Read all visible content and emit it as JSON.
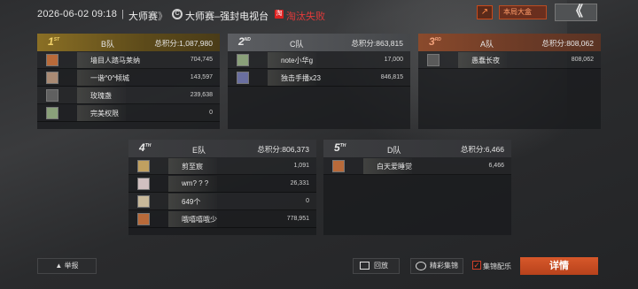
{
  "header": {
    "datetime": "2026-06-02 09:18",
    "separator": "|",
    "mode": "大师赛",
    "chevrons": "》",
    "ring_glyph": "C",
    "match_name": "大师赛–强封电视台",
    "result_box": "淘",
    "result_text": "淘汰失败",
    "share_glyph": "↗",
    "watch_label": "本局大盒",
    "back_glyph": "《"
  },
  "teams": [
    {
      "rank": "1",
      "rank_suffix": "ST",
      "name": "B队",
      "score_label": "总积分:1,087,980",
      "players": [
        {
          "name": "墙目人踏马莱纳",
          "score": "704,745"
        },
        {
          "name": "一谐^0^倾城",
          "score": "143,597"
        },
        {
          "name": "玫瑰盏",
          "score": "239,638"
        },
        {
          "name": "完美权限",
          "score": "0"
        }
      ]
    },
    {
      "rank": "2",
      "rank_suffix": "ND",
      "name": "C队",
      "score_label": "总积分:863,815",
      "players": [
        {
          "name": "note小华g",
          "score": "17,000"
        },
        {
          "name": "独击手播x23",
          "score": "846,815"
        }
      ]
    },
    {
      "rank": "3",
      "rank_suffix": "RD",
      "name": "A队",
      "score_label": "总积分:808,062",
      "players": [
        {
          "name": "愚蠢长夜",
          "score": "808,062"
        }
      ]
    },
    {
      "rank": "4",
      "rank_suffix": "TH",
      "name": "E队",
      "score_label": "总积分:806,373",
      "players": [
        {
          "name": "剪至宸",
          "score": "1,091"
        },
        {
          "name": "wm? ? ?",
          "score": "26,331"
        },
        {
          "name": "649个",
          "score": "0"
        },
        {
          "name": "哦嘻嘻哦少",
          "score": "778,951"
        }
      ]
    },
    {
      "rank": "5",
      "rank_suffix": "TH",
      "name": "D队",
      "score_label": "总积分:6,466",
      "players": [
        {
          "name": "白天爱睡觉",
          "score": "6,466"
        }
      ]
    }
  ],
  "footer": {
    "report_label": "举报",
    "replay_label": "回放",
    "highlight_label": "精彩集锦",
    "team_match_label": "集锦配乐",
    "detail_label": "详情"
  },
  "colors": {
    "gold": "#c9a23a",
    "silver": "#9a9ea3",
    "bronze": "#c27a4e",
    "accent": "#d7582a"
  }
}
